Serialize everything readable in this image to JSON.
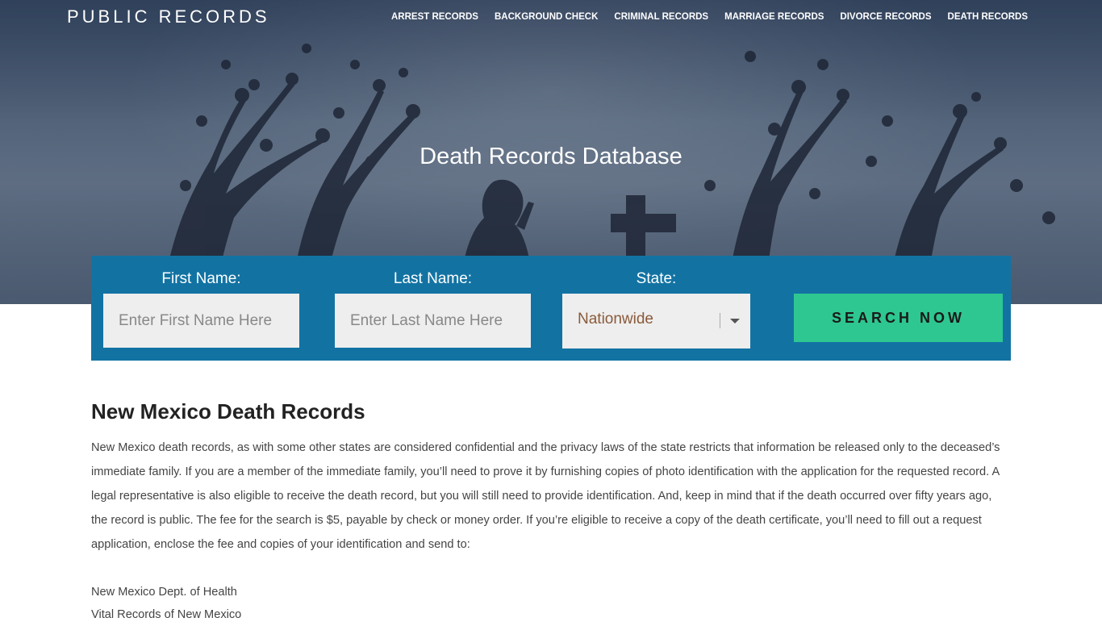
{
  "brand": "PUBLIC RECORDS",
  "nav": {
    "items": [
      "ARREST RECORDS",
      "BACKGROUND CHECK",
      "CRIMINAL RECORDS",
      "MARRIAGE RECORDS",
      "DIVORCE RECORDS",
      "DEATH RECORDS"
    ]
  },
  "hero": {
    "title": "Death Records Database"
  },
  "search": {
    "first_name_label": "First Name:",
    "first_name_placeholder": "Enter First Name Here",
    "last_name_label": "Last Name:",
    "last_name_placeholder": "Enter Last Name Here",
    "state_label": "State:",
    "state_value": "Nationwide",
    "button_label": "SEARCH NOW"
  },
  "content": {
    "heading": "New Mexico Death Records",
    "paragraph": "New Mexico death records, as with some other states are considered confidential and the privacy laws of the state restricts that information be released only to the deceased’s immediate family. If you are a member of the immediate family, you’ll need to prove it by furnishing copies of photo identification with the application for the requested record. A legal representative is also eligible to receive the death record, but you will still need to provide identification. And, keep in mind that if the death occurred over fifty years ago, the record is public. The fee for the search is $5, payable by check or money order. If you’re eligible to receive a copy of the death certificate, you’ll need to fill out a request application, enclose the fee and copies of your identification and send to:",
    "address_line_1": "New Mexico Dept. of Health",
    "address_line_2": "Vital Records of New Mexico"
  },
  "colors": {
    "panel": "#1273a3",
    "button": "#2ec791",
    "hero_sky": "#56687f"
  }
}
